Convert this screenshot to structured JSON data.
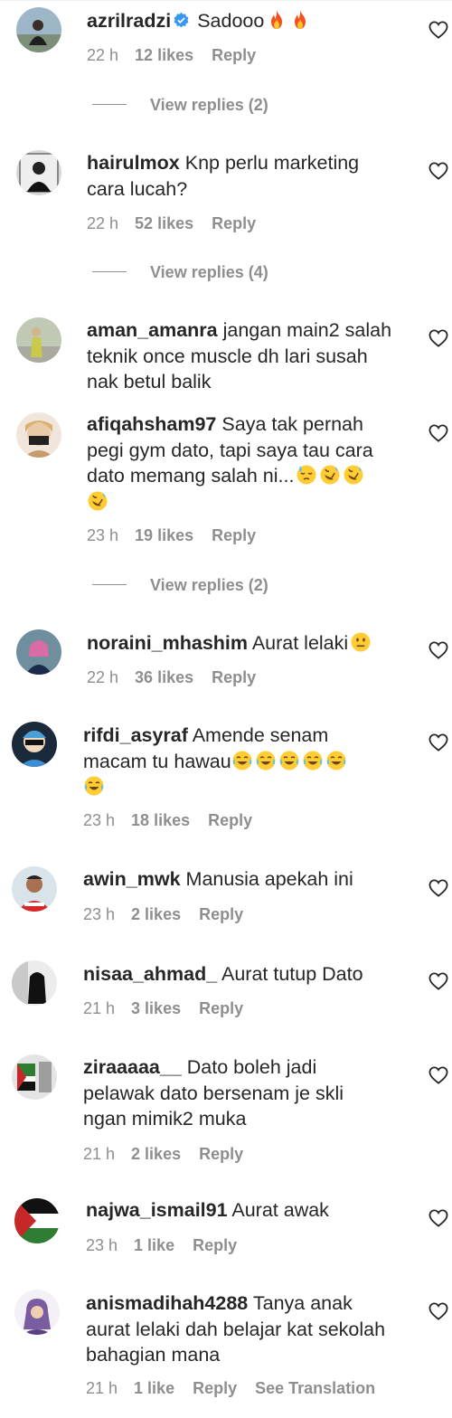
{
  "comments": [
    {
      "username": "azrilradzi",
      "verified": true,
      "text": "Sadooo",
      "emojis": [
        "fire",
        "fire"
      ],
      "time": "22 h",
      "likes": "12 likes",
      "reply": "Reply",
      "view_replies": "View replies (2)"
    },
    {
      "username": "hairulmox",
      "text_lines": [
        "Knp perlu marketing",
        "cara lucah?"
      ],
      "time": "22 h",
      "likes": "52 likes",
      "reply": "Reply",
      "view_replies": "View replies (4)"
    },
    {
      "username": "aman_amanra",
      "text_lines": [
        "jangan main2 salah",
        "teknik once muscle dh lari susah",
        "nak betul balik"
      ]
    },
    {
      "username": "afiqahsham97",
      "text_lines": [
        "Saya tak pernah",
        "pegi gym dato, tapi saya tau cara",
        "dato memang salah ni..."
      ],
      "emojis": [
        "sweat",
        "rofl",
        "rofl",
        "rofl"
      ],
      "time": "23 h",
      "likes": "19 likes",
      "reply": "Reply",
      "view_replies": "View replies (2)"
    },
    {
      "username": "noraini_mhashim",
      "text": "Aurat lelaki",
      "emojis": [
        "neutral"
      ],
      "time": "22 h",
      "likes": "36 likes",
      "reply": "Reply"
    },
    {
      "username": "rifdi_asyraf",
      "text_lines": [
        "Amende senam",
        "macam tu hawau"
      ],
      "emojis": [
        "joy",
        "joy",
        "joy",
        "joy",
        "joy",
        "joy"
      ],
      "time": "23 h",
      "likes": "18 likes",
      "reply": "Reply"
    },
    {
      "username": "awin_mwk",
      "text": "Manusia apekah ini",
      "time": "23 h",
      "likes": "2 likes",
      "reply": "Reply"
    },
    {
      "username": "nisaa_ahmad_",
      "text": "Aurat tutup Dato",
      "time": "21 h",
      "likes": "3 likes",
      "reply": "Reply"
    },
    {
      "username": "ziraaaaa__",
      "text_lines": [
        "Dato boleh jadi",
        "pelawak dato bersenam je skli",
        "ngan mimik2 muka"
      ],
      "time": "21 h",
      "likes": "2 likes",
      "reply": "Reply"
    },
    {
      "username": "najwa_ismail91",
      "text": "Aurat awak",
      "time": "23 h",
      "likes": "1 like",
      "reply": "Reply"
    },
    {
      "username": "anismadihah4288",
      "text_lines": [
        "Tanya anak",
        "aurat lelaki dah belajar kat sekolah",
        "bahagian mana"
      ],
      "time": "21 h",
      "likes": "1 like",
      "reply": "Reply",
      "see_translation": "See Translation"
    }
  ],
  "icons": {
    "like": "heart-outline-icon",
    "verified": "verified-badge-icon"
  },
  "colors": {
    "text": "#262626",
    "meta": "#8e8e8e",
    "verified": "#3897f0"
  }
}
